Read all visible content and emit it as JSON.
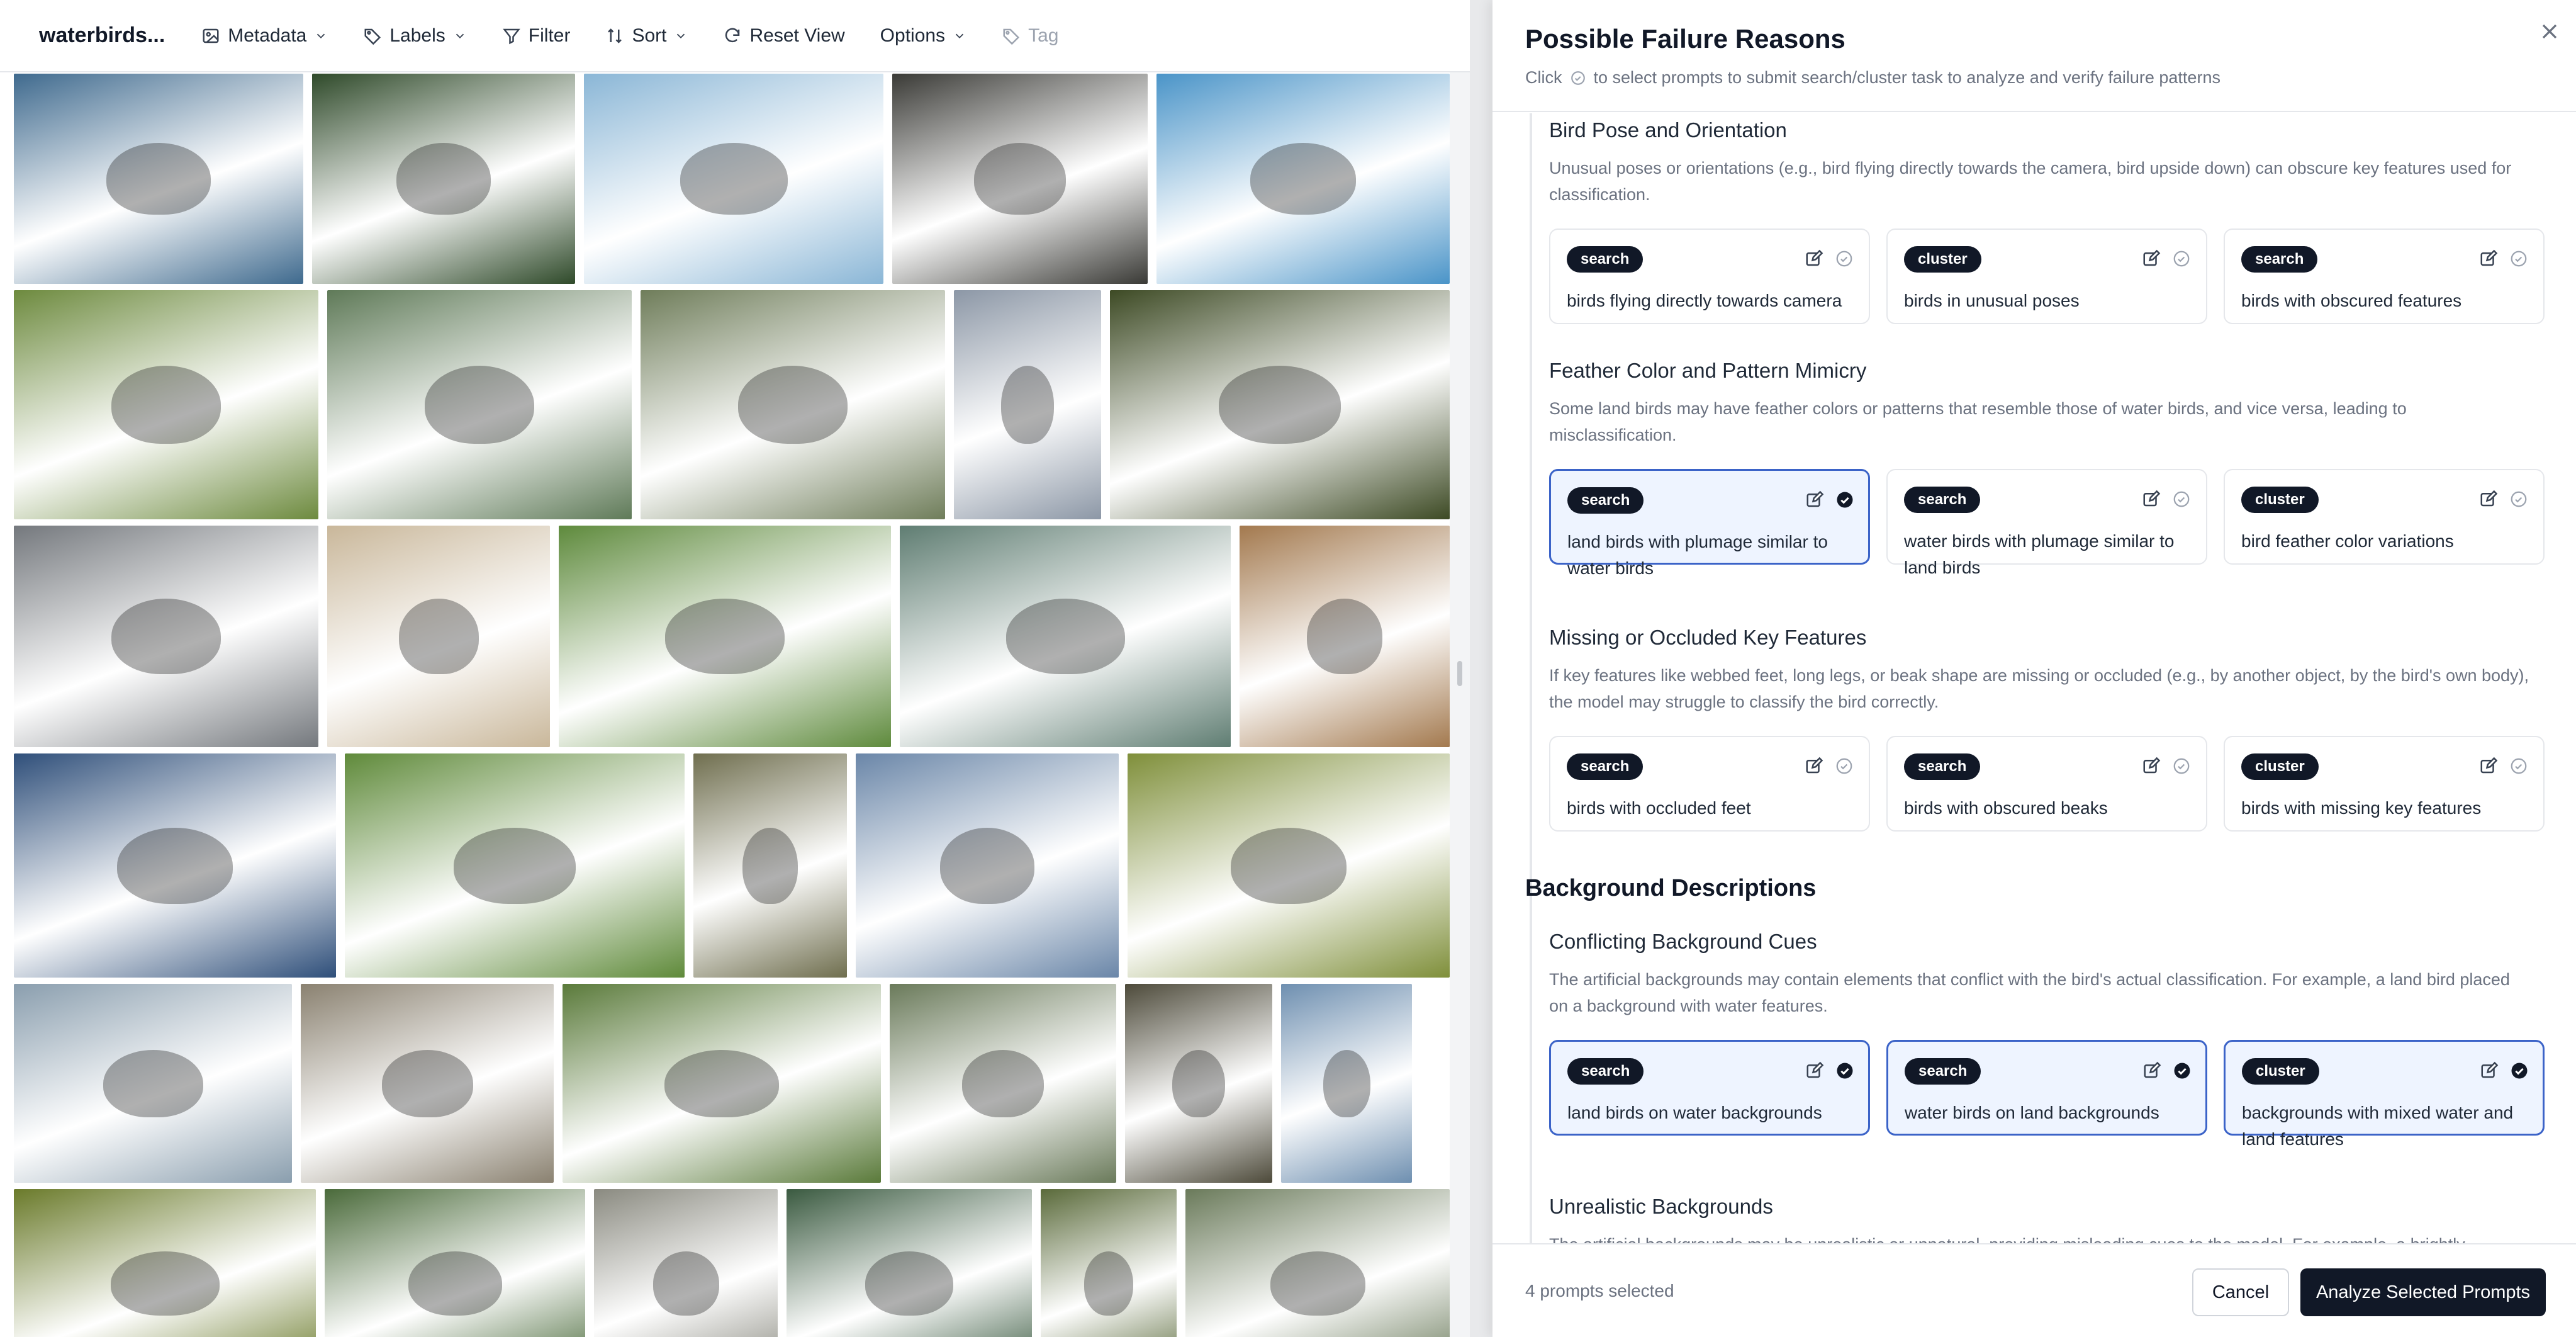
{
  "toolbar": {
    "dataset_name": "waterbirds...",
    "metadata": "Metadata",
    "labels": "Labels",
    "filter": "Filter",
    "sort": "Sort",
    "reset_view": "Reset View",
    "options": "Options",
    "tag": "Tag"
  },
  "panel": {
    "title": "Possible Failure Reasons",
    "subtitle_before": "Click",
    "subtitle_after": "to select prompts to submit search/cluster task to analyze and verify failure patterns",
    "sections": [
      {
        "title": "Bird Pose and Orientation",
        "description": "Unusual poses or orientations (e.g., bird flying directly towards the camera, bird upside down) can obscure key features used for classification.",
        "prompts": [
          {
            "type": "search",
            "text": "birds flying directly towards camera",
            "selected": false
          },
          {
            "type": "cluster",
            "text": "birds in unusual poses",
            "selected": false
          },
          {
            "type": "search",
            "text": "birds with obscured features",
            "selected": false
          }
        ]
      },
      {
        "title": "Feather Color and Pattern Mimicry",
        "description": "Some land birds may have feather colors or patterns that resemble those of water birds, and vice versa, leading to misclassification.",
        "prompts": [
          {
            "type": "search",
            "text": "land birds with plumage similar to water birds",
            "selected": true
          },
          {
            "type": "search",
            "text": "water birds with plumage similar to land birds",
            "selected": false
          },
          {
            "type": "cluster",
            "text": "bird feather color variations",
            "selected": false
          }
        ]
      },
      {
        "title": "Missing or Occluded Key Features",
        "description": "If key features like webbed feet, long legs, or beak shape are missing or occluded (e.g., by another object, by the bird's own body), the model may struggle to classify the bird correctly.",
        "prompts": [
          {
            "type": "search",
            "text": "birds with occluded feet",
            "selected": false
          },
          {
            "type": "search",
            "text": "birds with obscured beaks",
            "selected": false
          },
          {
            "type": "cluster",
            "text": "birds with missing key features",
            "selected": false
          }
        ]
      }
    ],
    "group_title": "Background Descriptions",
    "background_sections": [
      {
        "title": "Conflicting Background Cues",
        "description": "The artificial backgrounds may contain elements that conflict with the bird's actual classification. For example, a land bird placed on a background with water features.",
        "prompts": [
          {
            "type": "search",
            "text": "land birds on water backgrounds",
            "selected": true
          },
          {
            "type": "search",
            "text": "water birds on land backgrounds",
            "selected": true
          },
          {
            "type": "cluster",
            "text": "backgrounds with mixed water and land features",
            "selected": true
          }
        ]
      },
      {
        "title": "Unrealistic Backgrounds",
        "description": "The artificial backgrounds may be unrealistic or unnatural, providing misleading cues to the model. For example, a brightly"
      }
    ],
    "footer": {
      "selected_count": "4 prompts selected",
      "cancel": "Cancel",
      "analyze": "Analyze Selected Prompts"
    }
  },
  "gallery_rows": [
    [
      "#3f6a8e",
      "#2f4a2a",
      "#8ab6d6",
      "#3a3a36",
      "#4a94c8"
    ],
    [
      "#6d8a3e",
      "#5f7a58",
      "#6f7d5a",
      "#8c97a6",
      "#3d4a24"
    ],
    [
      "#74787d",
      "#c9b79a",
      "#5e8a3c",
      "#5f7d72",
      "#a3794e"
    ],
    [
      "#2f4f7a",
      "#5f8a3a",
      "#6f6e4e",
      "#6a86a8",
      "#7f8f3a"
    ],
    [
      "#8a9eae",
      "#8a8170",
      "#5a7a3a",
      "#6a7a5a",
      "#4d4a3a",
      "#6e8fb0"
    ],
    [
      "#6a7a2a",
      "#4a6a3a",
      "#8a8a80",
      "#3a5a40",
      "#5a6a3a",
      "#6a7a5a"
    ]
  ]
}
